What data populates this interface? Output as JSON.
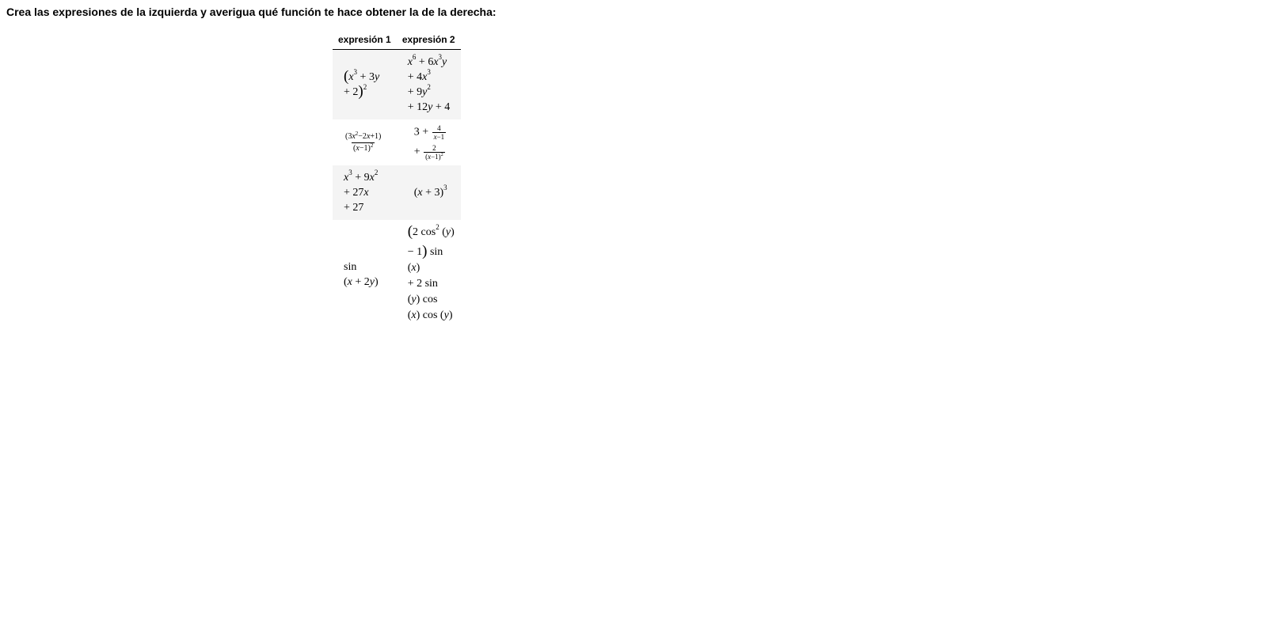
{
  "instruction": "Crea las expresiones de la izquierda y averigua qué función te hace obtener la de la derecha:",
  "table": {
    "headers": [
      "expresión 1",
      "expresión 2"
    ],
    "rows": [
      {
        "expr1_lines": [
          "(x³ + 3y",
          "+ 2)²"
        ],
        "expr2_lines": [
          "x⁶ + 6x³y",
          "+ 4x³",
          "+ 9y²",
          "+ 12y + 4"
        ]
      },
      {
        "expr1_lines": [
          "(3x²−2x+1) / (x−1)²"
        ],
        "expr2_lines": [
          "3 + 4/(x−1)",
          "+ 2/(x−1)²"
        ]
      },
      {
        "expr1_lines": [
          "x³ + 9x²",
          "+ 27x",
          "+ 27"
        ],
        "expr2_lines": [
          "(x + 3)³"
        ]
      },
      {
        "expr1_lines": [
          "sin",
          "(x + 2y)"
        ],
        "expr2_lines": [
          "(2 cos² (y)",
          "− 1) sin",
          "(x)",
          "+ 2 sin",
          "(y) cos",
          "(x) cos (y)"
        ]
      }
    ]
  }
}
